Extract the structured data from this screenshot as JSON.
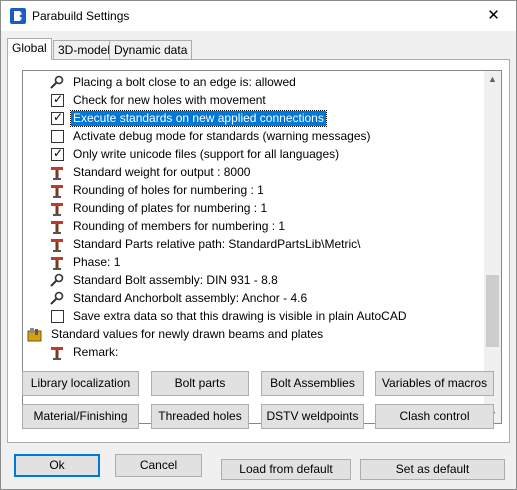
{
  "window": {
    "title": "Parabuild Settings",
    "close_glyph": "✕",
    "app_icon": "bricscad-icon"
  },
  "tabs": [
    {
      "label": "Global",
      "active": true
    },
    {
      "label": "3D-model",
      "active": false
    },
    {
      "label": "Dynamic data",
      "active": false
    }
  ],
  "tree": {
    "rows": [
      {
        "icon": "wrench-icon",
        "label": "Placing a bolt close to an edge is: allowed"
      },
      {
        "icon": "checkbox",
        "checked": true,
        "label": "Check for new holes with movement"
      },
      {
        "icon": "checkbox",
        "checked": true,
        "label": "Execute standards on new applied connections",
        "selected": true
      },
      {
        "icon": "checkbox",
        "checked": false,
        "label": "Activate debug mode for standards (warning messages)"
      },
      {
        "icon": "checkbox",
        "checked": true,
        "label": "Only write unicode files (support for all languages)"
      },
      {
        "icon": "text-tool-icon",
        "label": "Standard weight for output : 8000"
      },
      {
        "icon": "text-tool-icon",
        "label": "Rounding of holes for numbering : 1"
      },
      {
        "icon": "text-tool-icon",
        "label": "Rounding of plates for numbering : 1"
      },
      {
        "icon": "text-tool-icon",
        "label": "Rounding of members for numbering : 1"
      },
      {
        "icon": "text-tool-icon",
        "label": "Standard Parts relative path: StandardPartsLib\\Metric\\"
      },
      {
        "icon": "text-tool-icon",
        "label": "Phase: 1"
      },
      {
        "icon": "wrench-icon",
        "label": "Standard Bolt assembly: DIN 931 - 8.8"
      },
      {
        "icon": "wrench-icon",
        "label": "Standard Anchorbolt assembly: Anchor - 4.6"
      },
      {
        "icon": "checkbox",
        "checked": false,
        "label": "Save extra data so that this drawing is visible in plain AutoCAD"
      },
      {
        "icon": "beams-folder-icon",
        "label": "Standard values for newly drawn beams and plates",
        "level": 0
      },
      {
        "icon": "text-tool-icon",
        "label": "Remark:"
      }
    ]
  },
  "scrollbar": {
    "up_glyph": "▲",
    "down_glyph": "▼",
    "thumb_position_fraction": 0.62
  },
  "panel_buttons": [
    {
      "label": "Library localization"
    },
    {
      "label": "Bolt parts"
    },
    {
      "label": "Bolt Assemblies"
    },
    {
      "label": "Variables of macros"
    },
    {
      "label": "Material/Finishing"
    },
    {
      "label": "Threaded holes"
    },
    {
      "label": "DSTV weldpoints"
    },
    {
      "label": "Clash control"
    }
  ],
  "footer": {
    "ok_label": "Ok",
    "cancel_label": "Cancel",
    "load_default_label": "Load from default",
    "set_default_label": "Set as default"
  },
  "colors": {
    "selection": "#0078d7",
    "icon_red": "#c0392b",
    "icon_gold": "#d4a017"
  }
}
